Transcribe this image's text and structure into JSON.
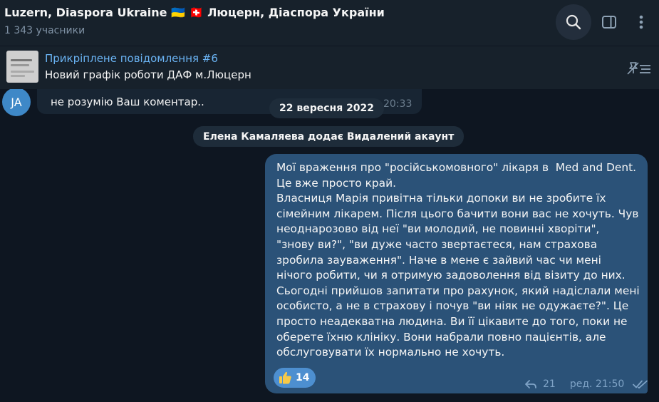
{
  "header": {
    "title": "Luzern, Diaspora Ukraine 🇺🇦 🇨🇭 Люцерн, Діаспора України",
    "members": "1 343 учасники",
    "icons": [
      "search-icon",
      "sidebar-icon",
      "more-icon"
    ]
  },
  "pinned": {
    "title": "Прикріплене повідомлення #6",
    "text": "Новий графік роботи ДАФ м.Люцерн"
  },
  "previous_message": {
    "avatar_initials": "JA",
    "text": "не розумію Ваш коментар..",
    "time": "20:33"
  },
  "date_separator": "22 вересня 2022",
  "service_message": "Елена Камаляева додає Видалений акаунт",
  "message": {
    "text": "Мої враження про \"російськомовного\" лікаря в  Med and Dent.\nЦе вже просто край.\nВласниця Марія привітна тільки допоки ви не зробите їх сімейним лікарем. Після цього бачити вони вас не хочуть. Чув неоднарозово від неї \"ви молодий, не повинні хворіти\", \"знову ви?\", \"ви дуже часто звертаєтеся, нам страхова зробила зауваження\". Наче в мене є зайвий час чи мені нічого робити, чи я отримую задоволення від візиту до них.  Сьогодні прийшов запитати про рахунок, який надіслали мені особисто, а не в страхову і почув \"ви ніяк не одужаєте?\". Це просто неадекватна людина. Ви її цікавите до того, поки не оберете їхню клініку. Вони набрали повно пацієнтів, але обслуговувати їх нормально не хочуть.",
    "reaction_count": "14",
    "replies": "21",
    "edited_time": "ред. 21:50"
  },
  "colors": {
    "background": "#0e1621",
    "header": "#17212b",
    "accent": "#6ab3f3",
    "outgoing_bubble": "#2b5278",
    "reaction": "#4d8fd0"
  }
}
